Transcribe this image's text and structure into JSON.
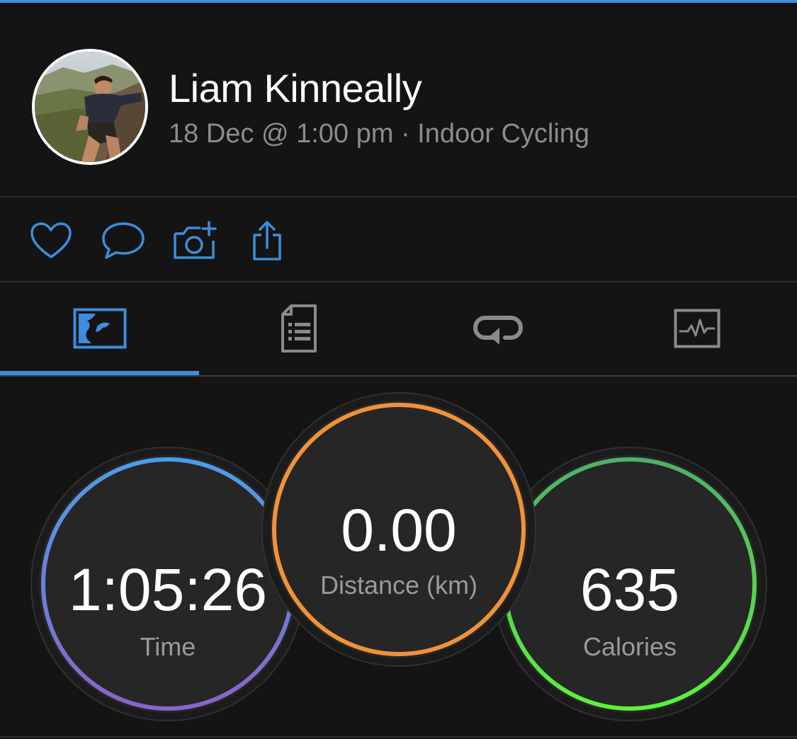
{
  "colors": {
    "accent": "#3d8ddb",
    "tab_inactive": "#8a8a8a",
    "time_ring_start": "#4a9ee8",
    "time_ring_end": "#8a64c8",
    "distance_ring": "#f0923a",
    "calories_ring_start": "#4fb06a",
    "calories_ring_end": "#5cf23a"
  },
  "header": {
    "user_name": "Liam Kinneally",
    "activity_meta": "18 Dec @ 1:00 pm · Indoor Cycling",
    "avatar_icon": "user-avatar-photo"
  },
  "actions": [
    {
      "name": "like",
      "icon": "heart-icon"
    },
    {
      "name": "comment",
      "icon": "comment-bubble-icon"
    },
    {
      "name": "add-photo",
      "icon": "camera-plus-icon"
    },
    {
      "name": "share",
      "icon": "share-icon"
    }
  ],
  "tabs": [
    {
      "name": "map",
      "icon": "map-icon",
      "active": true
    },
    {
      "name": "details",
      "icon": "document-list-icon",
      "active": false
    },
    {
      "name": "laps",
      "icon": "laps-loop-icon",
      "active": false
    },
    {
      "name": "charts",
      "icon": "heart-rate-chart-icon",
      "active": false
    }
  ],
  "stats": {
    "time": {
      "value": "1:05:26",
      "label": "Time"
    },
    "distance": {
      "value": "0.00",
      "label": "Distance (km)"
    },
    "calories": {
      "value": "635",
      "label": "Calories"
    }
  }
}
